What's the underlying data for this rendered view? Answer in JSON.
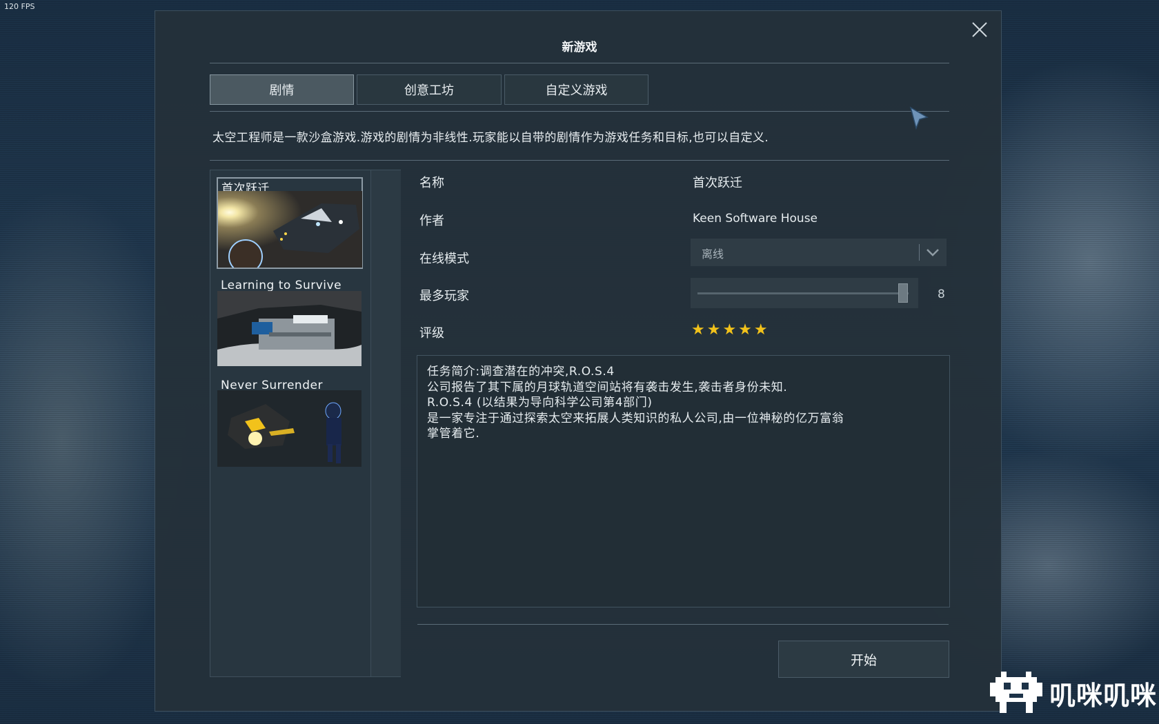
{
  "hud": {
    "fps": "120 FPS"
  },
  "dialog": {
    "title": "新游戏",
    "tabs": [
      {
        "label": "剧情",
        "active": true
      },
      {
        "label": "创意工坊",
        "active": false
      },
      {
        "label": "自定义游戏",
        "active": false
      }
    ],
    "description": "太空工程师是一款沙盒游戏.游戏的剧情为非线性.玩家能以自带的剧情作为游戏任务和目标,也可以自定义.",
    "scenarios": [
      {
        "name": "首次跃迁",
        "selected": true
      },
      {
        "name": "Learning to Survive",
        "selected": false
      },
      {
        "name": "Never Surrender",
        "selected": false
      }
    ],
    "details": {
      "name_label": "名称",
      "name_value": "首次跃迁",
      "author_label": "作者",
      "author_value": "Keen Software House",
      "online_label": "在线模式",
      "online_value": "离线",
      "max_players_label": "最多玩家",
      "max_players_value": "8",
      "rating_label": "评级",
      "rating_stars": "★★★★★",
      "rating_value": 5
    },
    "briefing": [
      "任务简介:调查潜在的冲突,R.O.S.4",
      "公司报告了其下属的月球轨道空间站将有袭击发生,袭击者身份未知.",
      "R.O.S.4 (以结果为导向科学公司第4部门)",
      "是一家专注于通过探索太空来拓展人类知识的私人公司,由一位神秘的亿万富翁",
      "掌管着它."
    ],
    "start_button": "开始"
  },
  "watermark": {
    "text": "叽咪叽咪"
  },
  "colors": {
    "accent_star": "#f2c21b",
    "panel_bg": "#24313a"
  }
}
